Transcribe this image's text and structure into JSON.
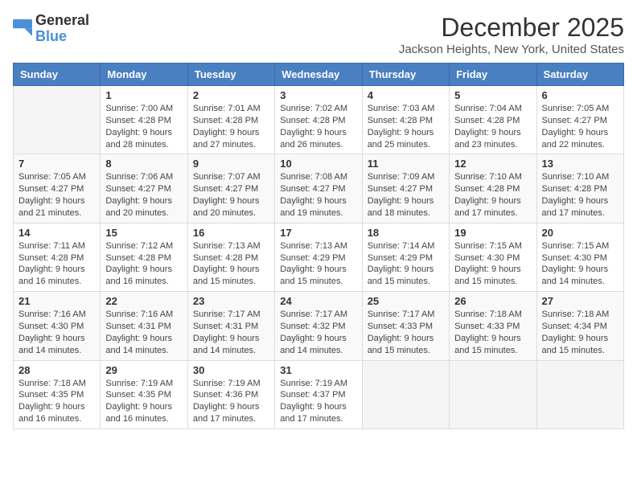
{
  "logo": {
    "general": "General",
    "blue": "Blue"
  },
  "title": "December 2025",
  "location": "Jackson Heights, New York, United States",
  "days_header": [
    "Sunday",
    "Monday",
    "Tuesday",
    "Wednesday",
    "Thursday",
    "Friday",
    "Saturday"
  ],
  "weeks": [
    [
      {
        "day": "",
        "info": ""
      },
      {
        "day": "1",
        "info": "Sunrise: 7:00 AM\nSunset: 4:28 PM\nDaylight: 9 hours and 28 minutes."
      },
      {
        "day": "2",
        "info": "Sunrise: 7:01 AM\nSunset: 4:28 PM\nDaylight: 9 hours and 27 minutes."
      },
      {
        "day": "3",
        "info": "Sunrise: 7:02 AM\nSunset: 4:28 PM\nDaylight: 9 hours and 26 minutes."
      },
      {
        "day": "4",
        "info": "Sunrise: 7:03 AM\nSunset: 4:28 PM\nDaylight: 9 hours and 25 minutes."
      },
      {
        "day": "5",
        "info": "Sunrise: 7:04 AM\nSunset: 4:28 PM\nDaylight: 9 hours and 23 minutes."
      },
      {
        "day": "6",
        "info": "Sunrise: 7:05 AM\nSunset: 4:27 PM\nDaylight: 9 hours and 22 minutes."
      }
    ],
    [
      {
        "day": "7",
        "info": "Sunrise: 7:05 AM\nSunset: 4:27 PM\nDaylight: 9 hours and 21 minutes."
      },
      {
        "day": "8",
        "info": "Sunrise: 7:06 AM\nSunset: 4:27 PM\nDaylight: 9 hours and 20 minutes."
      },
      {
        "day": "9",
        "info": "Sunrise: 7:07 AM\nSunset: 4:27 PM\nDaylight: 9 hours and 20 minutes."
      },
      {
        "day": "10",
        "info": "Sunrise: 7:08 AM\nSunset: 4:27 PM\nDaylight: 9 hours and 19 minutes."
      },
      {
        "day": "11",
        "info": "Sunrise: 7:09 AM\nSunset: 4:27 PM\nDaylight: 9 hours and 18 minutes."
      },
      {
        "day": "12",
        "info": "Sunrise: 7:10 AM\nSunset: 4:28 PM\nDaylight: 9 hours and 17 minutes."
      },
      {
        "day": "13",
        "info": "Sunrise: 7:10 AM\nSunset: 4:28 PM\nDaylight: 9 hours and 17 minutes."
      }
    ],
    [
      {
        "day": "14",
        "info": "Sunrise: 7:11 AM\nSunset: 4:28 PM\nDaylight: 9 hours and 16 minutes."
      },
      {
        "day": "15",
        "info": "Sunrise: 7:12 AM\nSunset: 4:28 PM\nDaylight: 9 hours and 16 minutes."
      },
      {
        "day": "16",
        "info": "Sunrise: 7:13 AM\nSunset: 4:28 PM\nDaylight: 9 hours and 15 minutes."
      },
      {
        "day": "17",
        "info": "Sunrise: 7:13 AM\nSunset: 4:29 PM\nDaylight: 9 hours and 15 minutes."
      },
      {
        "day": "18",
        "info": "Sunrise: 7:14 AM\nSunset: 4:29 PM\nDaylight: 9 hours and 15 minutes."
      },
      {
        "day": "19",
        "info": "Sunrise: 7:15 AM\nSunset: 4:30 PM\nDaylight: 9 hours and 15 minutes."
      },
      {
        "day": "20",
        "info": "Sunrise: 7:15 AM\nSunset: 4:30 PM\nDaylight: 9 hours and 14 minutes."
      }
    ],
    [
      {
        "day": "21",
        "info": "Sunrise: 7:16 AM\nSunset: 4:30 PM\nDaylight: 9 hours and 14 minutes."
      },
      {
        "day": "22",
        "info": "Sunrise: 7:16 AM\nSunset: 4:31 PM\nDaylight: 9 hours and 14 minutes."
      },
      {
        "day": "23",
        "info": "Sunrise: 7:17 AM\nSunset: 4:31 PM\nDaylight: 9 hours and 14 minutes."
      },
      {
        "day": "24",
        "info": "Sunrise: 7:17 AM\nSunset: 4:32 PM\nDaylight: 9 hours and 14 minutes."
      },
      {
        "day": "25",
        "info": "Sunrise: 7:17 AM\nSunset: 4:33 PM\nDaylight: 9 hours and 15 minutes."
      },
      {
        "day": "26",
        "info": "Sunrise: 7:18 AM\nSunset: 4:33 PM\nDaylight: 9 hours and 15 minutes."
      },
      {
        "day": "27",
        "info": "Sunrise: 7:18 AM\nSunset: 4:34 PM\nDaylight: 9 hours and 15 minutes."
      }
    ],
    [
      {
        "day": "28",
        "info": "Sunrise: 7:18 AM\nSunset: 4:35 PM\nDaylight: 9 hours and 16 minutes."
      },
      {
        "day": "29",
        "info": "Sunrise: 7:19 AM\nSunset: 4:35 PM\nDaylight: 9 hours and 16 minutes."
      },
      {
        "day": "30",
        "info": "Sunrise: 7:19 AM\nSunset: 4:36 PM\nDaylight: 9 hours and 17 minutes."
      },
      {
        "day": "31",
        "info": "Sunrise: 7:19 AM\nSunset: 4:37 PM\nDaylight: 9 hours and 17 minutes."
      },
      {
        "day": "",
        "info": ""
      },
      {
        "day": "",
        "info": ""
      },
      {
        "day": "",
        "info": ""
      }
    ]
  ]
}
